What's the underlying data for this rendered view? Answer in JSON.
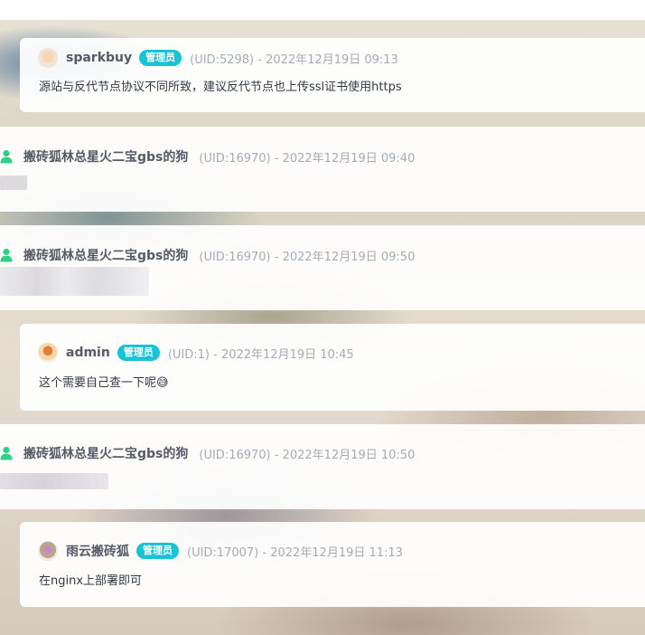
{
  "comments": [
    {
      "name": "sparkbuy",
      "badge": "管理员",
      "meta": "(UID:5298) - 2022年12月19日 09:13",
      "text": "源站与反代节点协议不同所致，建议反代节点也上传ssl证书使用https"
    },
    {
      "name": "搬砖狐林总星火二宝gbs的狗",
      "meta": "(UID:16970) - 2022年12月19日 09:40"
    },
    {
      "name": "搬砖狐林总星火二宝gbs的狗",
      "meta": "(UID:16970) - 2022年12月19日 09:50"
    },
    {
      "name": "admin",
      "badge": "管理员",
      "meta": "(UID:1) - 2022年12月19日 10:45",
      "text": "这个需要自己查一下呢😅"
    },
    {
      "name": "搬砖狐林总星火二宝gbs的狗",
      "meta": "(UID:16970) - 2022年12月19日 10:50"
    },
    {
      "name": "雨云搬砖狐",
      "badge": "管理员",
      "meta": "(UID:17007) - 2022年12月19日 11:13",
      "text": "在nginx上部署即可"
    }
  ],
  "colors": {
    "badge": "#19c3d6",
    "user_icon": "#2fcf86"
  }
}
